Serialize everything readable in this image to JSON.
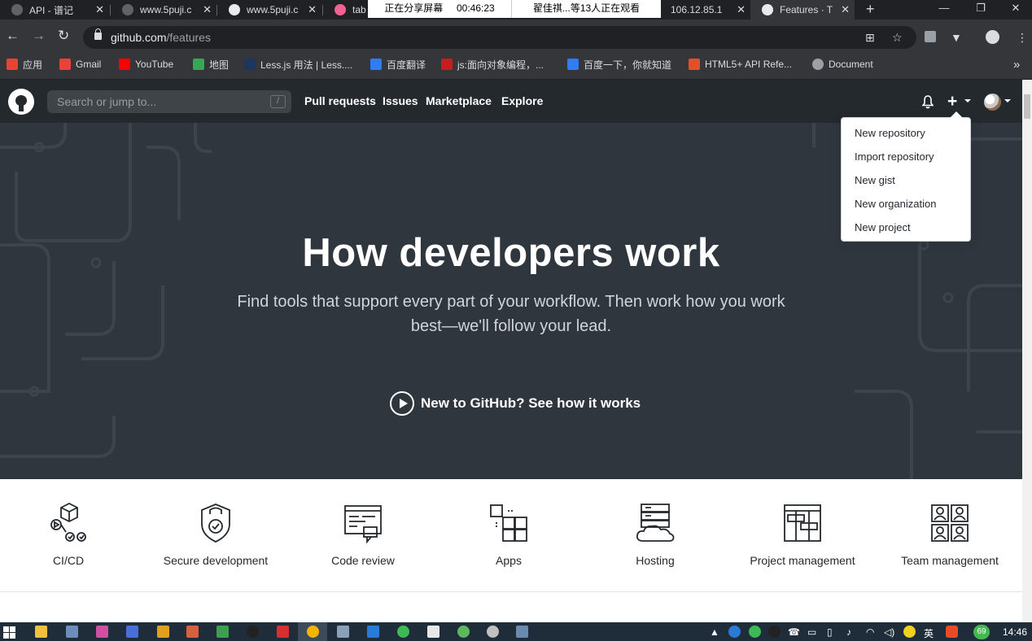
{
  "browser": {
    "tabs": [
      {
        "title": "API - 谱记",
        "close": "✕"
      },
      {
        "title": "www.5puji.c",
        "close": "✕"
      },
      {
        "title": "www.5puji.c",
        "close": "✕"
      },
      {
        "title": "tab",
        "close": "✕"
      },
      {
        "title": "106.12.85.1",
        "close": "✕"
      },
      {
        "title": "Features · T",
        "close": "✕"
      }
    ],
    "new_tab": "+",
    "window_controls": {
      "minimize": "—",
      "maximize": "❐",
      "close": "✕"
    },
    "share_status": {
      "sharing": "正在分享屏幕",
      "timer": "00:46:23",
      "viewers": "翟佳祺...等13人正在观看"
    },
    "nav": {
      "back": "←",
      "forward": "→",
      "reload": "↻"
    },
    "url": {
      "host": "github.com",
      "path": "/features"
    },
    "bookmarks": [
      {
        "label": "应用",
        "icon": "apps-grid-icon",
        "color": "#ea4335"
      },
      {
        "label": "Gmail",
        "icon": "gmail-icon",
        "color": "#ea4335"
      },
      {
        "label": "YouTube",
        "icon": "youtube-icon",
        "color": "#ff0000"
      },
      {
        "label": "地图",
        "icon": "maps-icon",
        "color": "#34a853"
      },
      {
        "label": "Less.js 用法 | Less....",
        "icon": "less-icon",
        "color": "#1d365d"
      },
      {
        "label": "百度翻译",
        "icon": "translate-icon",
        "color": "#2f7cf6"
      },
      {
        "label": "js:面向对象编程，...",
        "icon": "csdn-icon",
        "color": "#c91d1d"
      },
      {
        "label": "百度一下，你就知道",
        "icon": "baidu-icon",
        "color": "#2f7cf6"
      },
      {
        "label": "HTML5+ API Refe...",
        "icon": "html5-icon",
        "color": "#e34f26"
      },
      {
        "label": "Document",
        "icon": "globe-icon",
        "color": "#9aa0a6"
      }
    ],
    "bookmarks_more": "»"
  },
  "github": {
    "search_placeholder": "Search or jump to...",
    "search_shortcut": "/",
    "nav": [
      "Pull requests",
      "Issues",
      "Marketplace",
      "Explore"
    ],
    "plus": "+",
    "dropdown": [
      "New repository",
      "Import repository",
      "New gist",
      "New organization",
      "New project"
    ]
  },
  "hero": {
    "title": "How developers work",
    "subtitle": "Find tools that support every part of your workflow. Then work how you work best—we'll follow your lead.",
    "link": "New to GitHub? See how it works"
  },
  "features": [
    {
      "label": "CI/CD",
      "icon": "ci-cd-icon"
    },
    {
      "label": "Secure development",
      "icon": "shield-lock-icon"
    },
    {
      "label": "Code review",
      "icon": "code-review-icon"
    },
    {
      "label": "Apps",
      "icon": "apps-icon"
    },
    {
      "label": "Hosting",
      "icon": "hosting-cloud-icon"
    },
    {
      "label": "Project management",
      "icon": "project-board-icon"
    },
    {
      "label": "Team management",
      "icon": "team-icon"
    }
  ],
  "taskbar": {
    "badge": "69",
    "ime": "英",
    "time": "14:46"
  }
}
